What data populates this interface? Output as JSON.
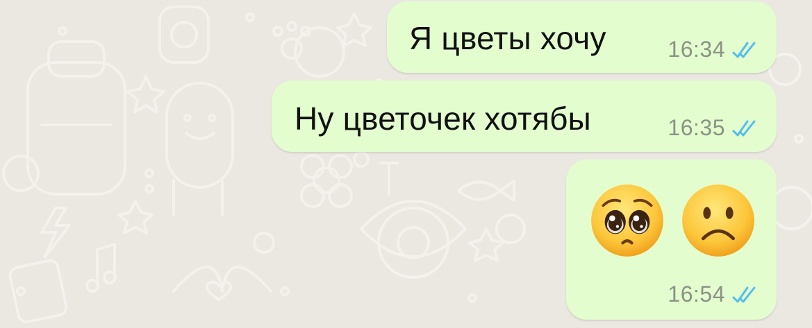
{
  "chat": {
    "messages": [
      {
        "text": "Я цветы хочу",
        "time": "16:34",
        "status": "read-double-check"
      },
      {
        "text": "Ну цветочек хотябы",
        "time": "16:35",
        "status": "read-double-check"
      },
      {
        "emojis": [
          "pleading-face-emoji",
          "frowning-face-emoji"
        ],
        "time": "16:54",
        "status": "read-double-check"
      }
    ]
  },
  "colors": {
    "background": "#ebe7e1",
    "outgoing_bubble": "#e3fdcf",
    "time_text": "#8b9285",
    "read_ticks": "#53bdeb"
  }
}
